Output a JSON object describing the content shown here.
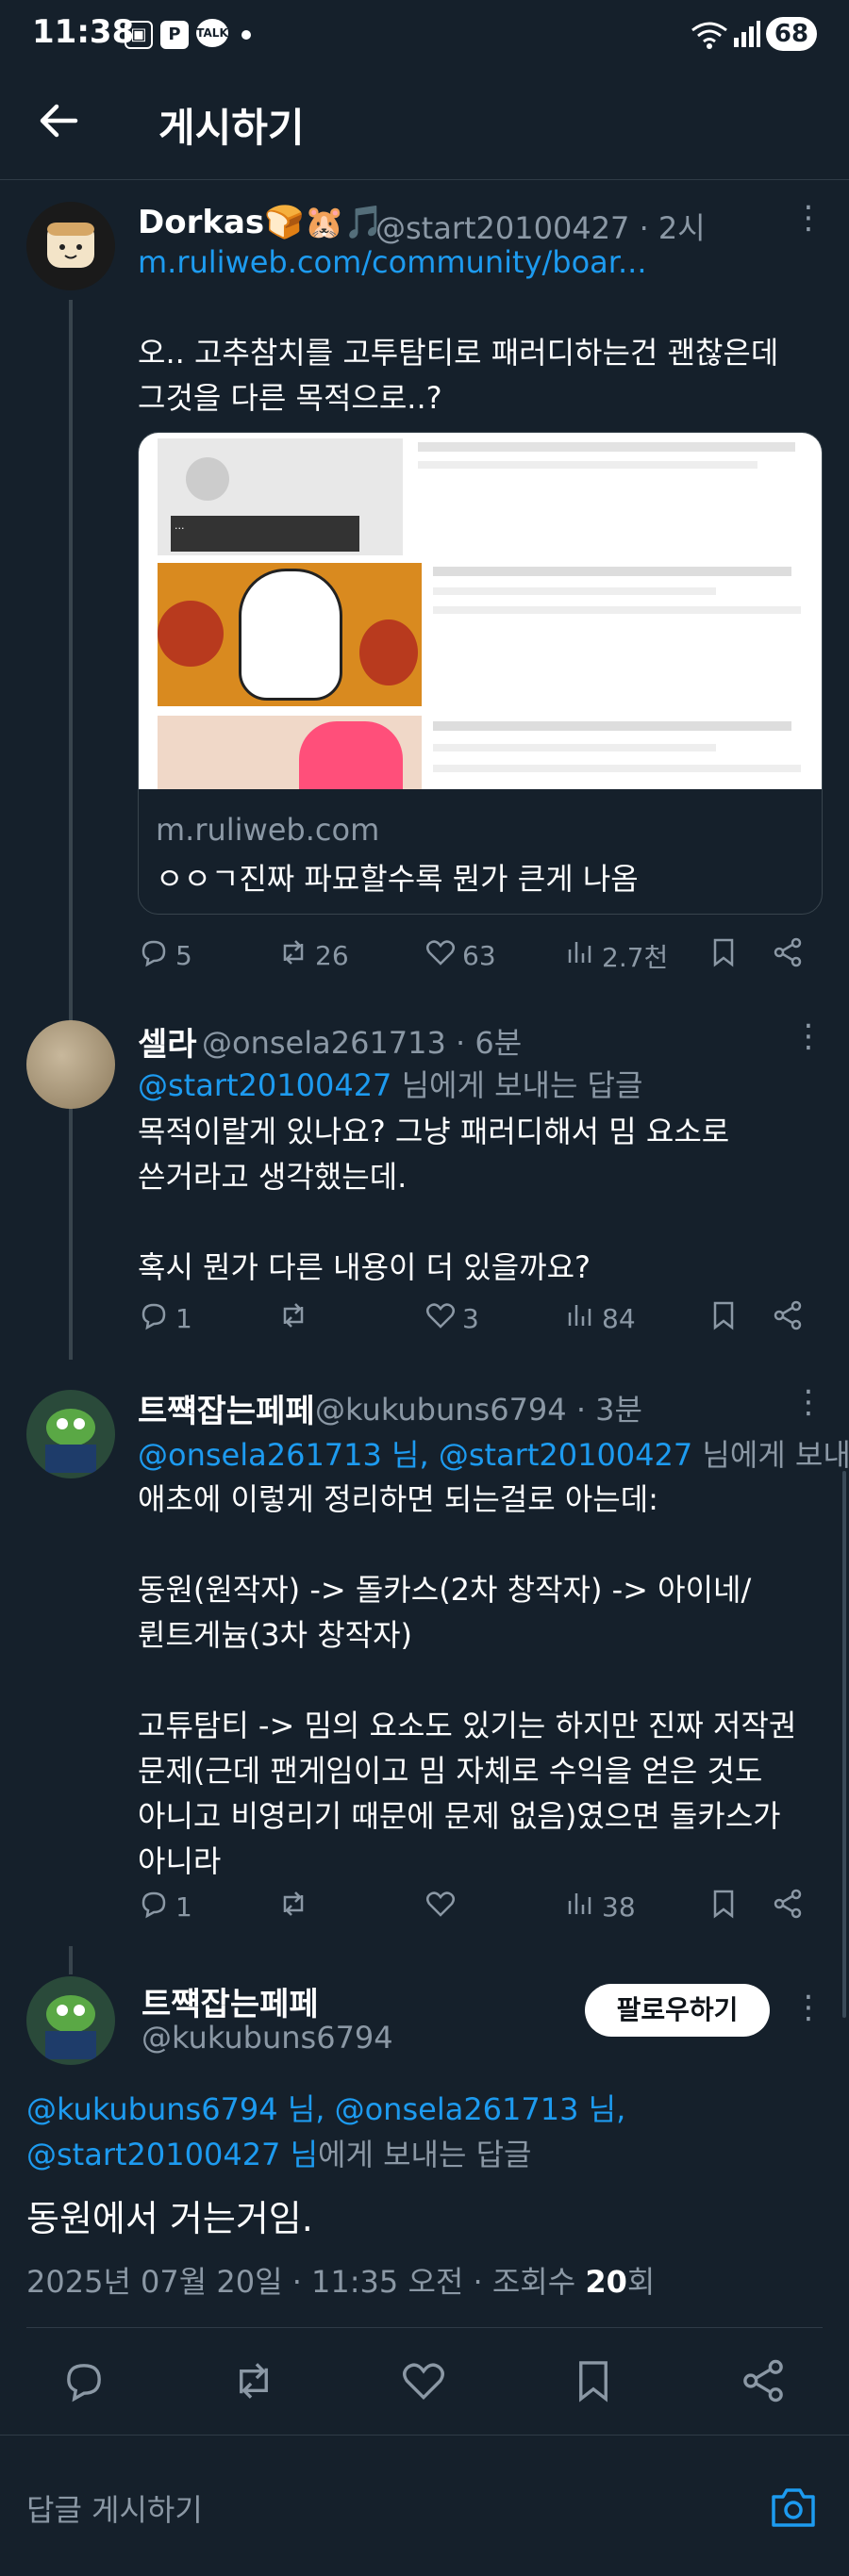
{
  "status": {
    "time": "11:38",
    "icons": [
      "screen-record-icon",
      "p-app-icon",
      "talk-icon"
    ],
    "battery": "68"
  },
  "header": {
    "title": "게시하기"
  },
  "post1": {
    "name": "Dorkas🍞🐹🎵",
    "handle": "@start20100427 · 2시",
    "link": "m.ruliweb.com/community/boar...",
    "text": "오.. 고추참치를 고투탐티로 패러디하는건 괜찮은데\n그것을 다른 목적으로..?",
    "card_domain": "m.ruliweb.com",
    "card_title": "ㅇㅇㄱ진짜 파묘할수록 뭔가 큰게 나옴",
    "replies": "5",
    "retweets": "26",
    "likes": "63",
    "views": "2.7천"
  },
  "post2": {
    "name": "셀라",
    "handle": "@onsela261713 · 6분",
    "reply_to_user": "@start20100427",
    "reply_suffix": " 님에게 보내는 답글",
    "text": "목적이랄게 있나요? 그냥 패러디해서 밈 요소로\n쓴거라고 생각했는데.\n\n혹시 뭔가 다른 내용이 더 있을까요?",
    "replies": "1",
    "retweets": "",
    "likes": "3",
    "views": "84"
  },
  "post3": {
    "name": "트쨱잡는페페",
    "handle": "@kukubuns6794 · 3분",
    "reply_to_users": "@onsela261713 님, @start20100427",
    "reply_suffix": " 님에게 보내는",
    "text": "애초에 이렇게 정리하면 되는걸로 아는데:\n\n동원(원작자) -> 돌카스(2차 창작자) -> 아이네/\n륀트게늄(3차 창작자)\n\n고튜탐티 -> 밈의 요소도 있기는 하지만 진짜 저작권\n문제(근데 팬게임이고 밈 자체로 수익을 얻은 것도\n아니고 비영리기 때문에 문제 없음)였으면 돌카스가\n아니라",
    "replies": "1",
    "retweets": "",
    "likes": "",
    "views": "38"
  },
  "main": {
    "name": "트쨱잡는페페",
    "handle": "@kukubuns6794",
    "follow_label": "팔로우하기",
    "reply_to_users": "@kukubuns6794 님, @onsela261713 님,",
    "reply_to_user2": "@start20100427 님",
    "reply_suffix": "에게 보내는 답글",
    "text": "동원에서 거는거임.",
    "meta_prefix": "2025년 07월 20일 · 11:35 오전 · 조회수 ",
    "views_count": "20",
    "views_suffix": "회"
  },
  "composer": {
    "placeholder": "답글 게시하기"
  }
}
